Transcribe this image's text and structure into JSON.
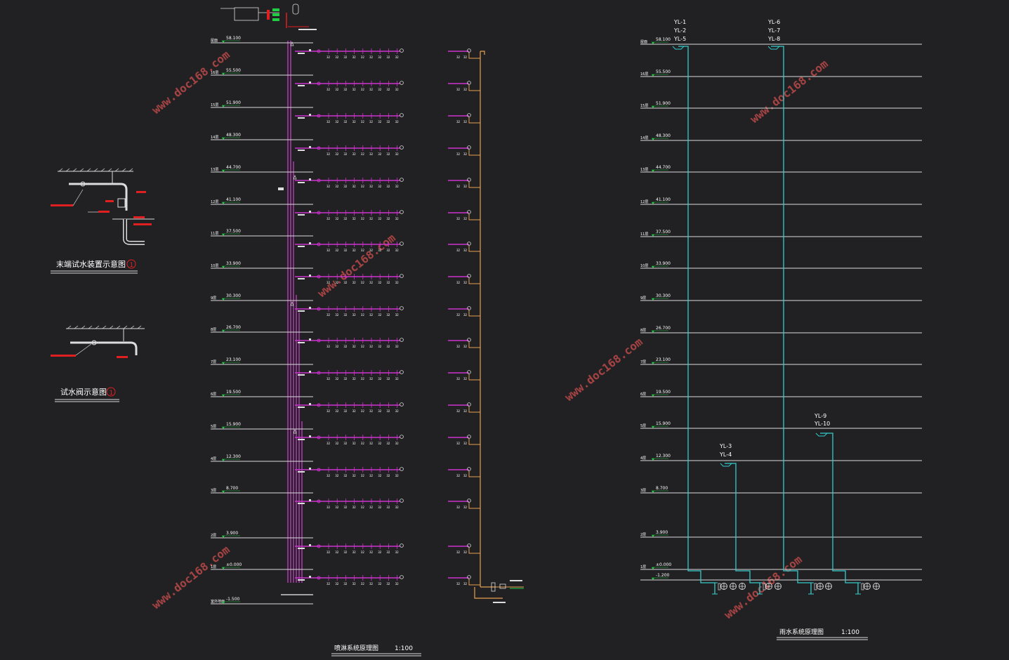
{
  "colors": {
    "background": "#212123",
    "floor_line": "#dcdcdc",
    "sprinkler_pipe": "#cc33cc",
    "fire_riser": "#d040d0",
    "drain_pipe": "#e8a050",
    "rain_pipe": "#33cccc",
    "elevation_mark": "#22cc44",
    "tag_red": "#e02020",
    "watermark": "#c24b4b",
    "label_white": "#ffffff"
  },
  "watermark": "www.doc168.com",
  "detail_1": {
    "title": "末端试水装置示意图",
    "circle_no": "1"
  },
  "detail_2": {
    "title": "试水阀示意图",
    "circle_no": "1"
  },
  "sprinkler_diagram": {
    "title": "喷淋系统原理图",
    "scale": "1:100"
  },
  "rain_diagram": {
    "title": "雨水系统原理图",
    "scale": "1:100",
    "riser_tags": {
      "group_a": [
        "YL-1",
        "YL-2",
        "YL-5"
      ],
      "group_b": [
        "YL-6",
        "YL-7",
        "YL-8"
      ],
      "group_c": [
        "YL-3",
        "YL-4"
      ],
      "group_d": [
        "YL-9",
        "YL-10"
      ]
    }
  },
  "sprinkler_floors": [
    {
      "floor": "屋面",
      "elev": "58.100"
    },
    {
      "floor": "16层",
      "elev": "55.500"
    },
    {
      "floor": "15层",
      "elev": "51.900"
    },
    {
      "floor": "14层",
      "elev": "48.300"
    },
    {
      "floor": "13层",
      "elev": "44.700"
    },
    {
      "floor": "12层",
      "elev": "41.100"
    },
    {
      "floor": "11层",
      "elev": "37.500"
    },
    {
      "floor": "10层",
      "elev": "33.900"
    },
    {
      "floor": "9层",
      "elev": "30.300"
    },
    {
      "floor": "8层",
      "elev": "26.700"
    },
    {
      "floor": "7层",
      "elev": "23.100"
    },
    {
      "floor": "6层",
      "elev": "19.500"
    },
    {
      "floor": "5层",
      "elev": "15.900"
    },
    {
      "floor": "4层",
      "elev": "12.300"
    },
    {
      "floor": "3层",
      "elev": "8.700"
    },
    {
      "floor": "2层",
      "elev": "3.900"
    },
    {
      "floor": "1层",
      "elev": "±0.000"
    },
    {
      "floor": "室外地面",
      "elev": "-1.500"
    }
  ],
  "rain_floors": [
    {
      "floor": "屋面",
      "elev": "58.100"
    },
    {
      "floor": "16层",
      "elev": "55.500"
    },
    {
      "floor": "15层",
      "elev": "51.900"
    },
    {
      "floor": "14层",
      "elev": "48.300"
    },
    {
      "floor": "13层",
      "elev": "44.700"
    },
    {
      "floor": "12层",
      "elev": "41.100"
    },
    {
      "floor": "11层",
      "elev": "37.500"
    },
    {
      "floor": "10层",
      "elev": "33.900"
    },
    {
      "floor": "9层",
      "elev": "30.300"
    },
    {
      "floor": "8层",
      "elev": "26.700"
    },
    {
      "floor": "7层",
      "elev": "23.100"
    },
    {
      "floor": "6层",
      "elev": "19.500"
    },
    {
      "floor": "5层",
      "elev": "15.900"
    },
    {
      "floor": "4层",
      "elev": "12.300"
    },
    {
      "floor": "3层",
      "elev": "8.700"
    },
    {
      "floor": "2层",
      "elev": "3.900"
    },
    {
      "floor": "1层",
      "elev": "±0.000"
    },
    {
      "floor": "",
      "elev": "-1.200"
    }
  ]
}
